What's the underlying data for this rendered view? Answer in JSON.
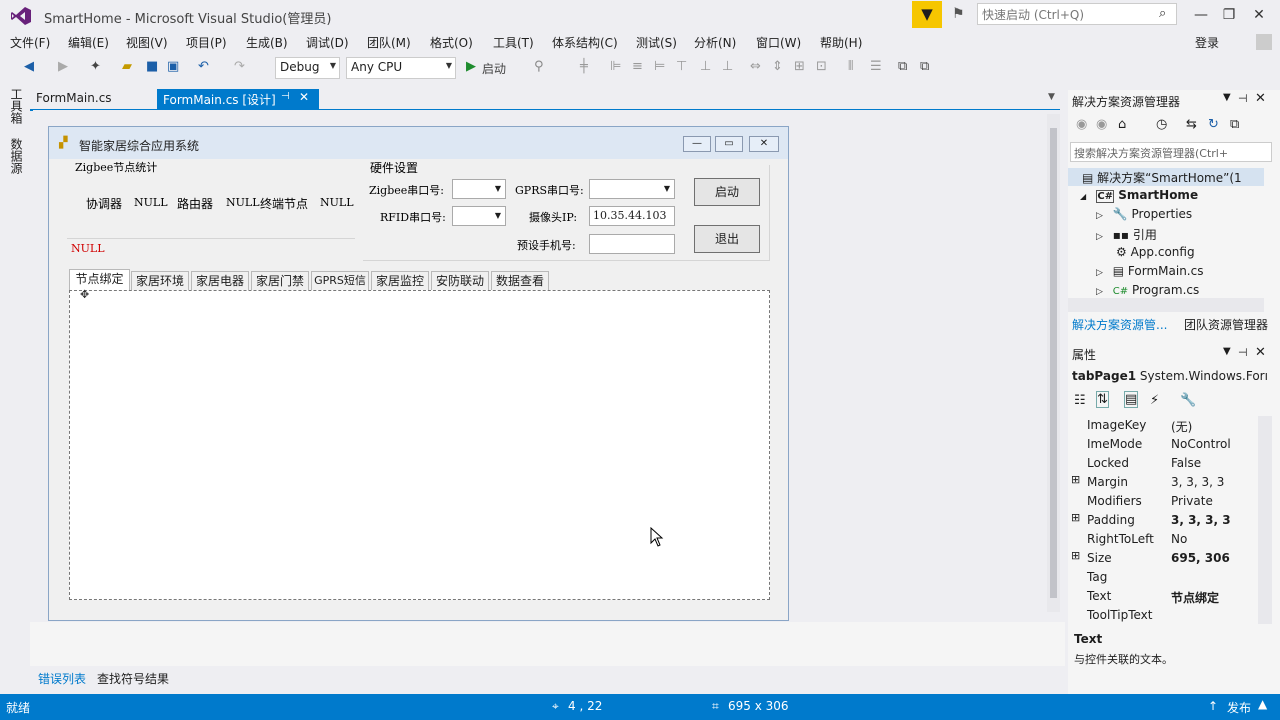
{
  "app": {
    "title": "SmartHome - Microsoft Visual Studio(管理员)",
    "quick_launch_placeholder": "快速启动 (Ctrl+Q)",
    "login": "登录"
  },
  "menu": [
    "文件(F)",
    "编辑(E)",
    "视图(V)",
    "项目(P)",
    "生成(B)",
    "调试(D)",
    "团队(M)",
    "格式(O)",
    "工具(T)",
    "体系结构(C)",
    "测试(S)",
    "分析(N)",
    "窗口(W)",
    "帮助(H)"
  ],
  "toolbar": {
    "config": "Debug",
    "platform": "Any CPU",
    "start_label": "启动"
  },
  "left_tabs": [
    "工具箱",
    "数据源"
  ],
  "doc_tabs": [
    {
      "label": "FormMain.cs"
    },
    {
      "label": "FormMain.cs [设计]",
      "active": true
    }
  ],
  "form": {
    "title": "智能家居综合应用系统",
    "zigbee_group": "Zigbee节点统计",
    "coordinator_label": "协调器",
    "coordinator_value": "NULL",
    "router_label": "路由器",
    "router_value": "NULL",
    "terminal_label": "终端节点",
    "terminal_value": "NULL",
    "status_text": "NULL",
    "hw_group": "硬件设置",
    "zigbee_port_label": "Zigbee串口号:",
    "gprs_port_label": "GPRS串口号:",
    "rfid_port_label": "RFID串口号:",
    "camera_ip_label": "摄像头IP:",
    "camera_ip_value": "10.35.44.103",
    "phone_label": "预设手机号:",
    "phone_value": "",
    "start_button": "启动",
    "exit_button": "退出",
    "tabs": [
      "节点绑定",
      "家居环境",
      "家居电器",
      "家居门禁",
      "GPRS短信",
      "家居监控",
      "安防联动",
      "数据查看"
    ]
  },
  "solution": {
    "panel_title": "解决方案资源管理器",
    "search_placeholder": "搜索解决方案资源管理器(Ctrl+",
    "items": [
      {
        "label": "解决方案“SmartHome”(1",
        "indent": 0,
        "icon": "solution-icon",
        "bold": false
      },
      {
        "label": "SmartHome",
        "indent": 1,
        "icon": "csharp-project-icon",
        "bold": true
      },
      {
        "label": "Properties",
        "indent": 2,
        "icon": "wrench-icon",
        "bold": false
      },
      {
        "label": "引用",
        "indent": 2,
        "icon": "reference-icon",
        "bold": false
      },
      {
        "label": "App.config",
        "indent": 2,
        "icon": "config-file-icon",
        "bold": false
      },
      {
        "label": "FormMain.cs",
        "indent": 2,
        "icon": "form-icon",
        "bold": false
      },
      {
        "label": "Program.cs",
        "indent": 2,
        "icon": "csharp-file-icon",
        "bold": false
      }
    ],
    "tab_solution": "解决方案资源管...",
    "tab_team": "团队资源管理器"
  },
  "properties": {
    "panel_title": "属性",
    "object_name": "tabPage1",
    "object_type": "System.Windows.Forı",
    "rows": [
      {
        "key": "ImageKey",
        "value": "(无)",
        "expand": false,
        "bold": false
      },
      {
        "key": "ImeMode",
        "value": "NoControl",
        "expand": false,
        "bold": false
      },
      {
        "key": "Locked",
        "value": "False",
        "expand": false,
        "bold": false
      },
      {
        "key": "Margin",
        "value": "3, 3, 3, 3",
        "expand": true,
        "bold": false
      },
      {
        "key": "Modifiers",
        "value": "Private",
        "expand": false,
        "bold": false
      },
      {
        "key": "Padding",
        "value": "3, 3, 3, 3",
        "expand": true,
        "bold": true
      },
      {
        "key": "RightToLeft",
        "value": "No",
        "expand": false,
        "bold": false
      },
      {
        "key": "Size",
        "value": "695, 306",
        "expand": true,
        "bold": true
      },
      {
        "key": "Tag",
        "value": "",
        "expand": false,
        "bold": false
      },
      {
        "key": "Text",
        "value": "节点绑定",
        "expand": false,
        "bold": true
      },
      {
        "key": "ToolTipText",
        "value": "",
        "expand": false,
        "bold": false
      }
    ],
    "desc_title": "Text",
    "desc_text": "与控件关联的文本。"
  },
  "bottom_tabs": [
    "错误列表",
    "查找符号结果"
  ],
  "status": {
    "left": "就绪",
    "position": "4 , 22",
    "size": "695 x 306",
    "publish": "发布"
  },
  "colors": {
    "accent": "#007acc",
    "filter": "#f6c600",
    "status_red": "#d00000"
  }
}
